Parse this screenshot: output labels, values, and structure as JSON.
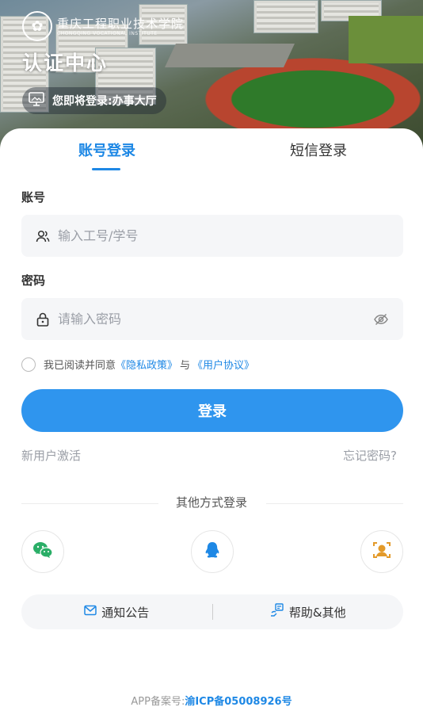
{
  "hero": {
    "logo_text": "重庆工程职业技术学院",
    "logo_sub": "CHONGQING VOCATIONAL INSTITUTE",
    "title": "认证中心",
    "pill_text": "您即将登录:办事大厅"
  },
  "tabs": [
    {
      "label": "账号登录"
    },
    {
      "label": "短信登录"
    }
  ],
  "form": {
    "account_label": "账号",
    "account_placeholder": "输入工号/学号",
    "password_label": "密码",
    "password_placeholder": "请输入密码",
    "agree_prefix": "我已阅读并同意",
    "privacy_link": "《隐私政策》",
    "agree_and": "与",
    "user_agreement_link": "《用户协议》",
    "login_button": "登录",
    "activate_link": "新用户激活",
    "forgot_link": "忘记密码?"
  },
  "other": {
    "title": "其他方式登录",
    "methods": [
      {
        "icon": "wechat-icon",
        "color": "#2aae67"
      },
      {
        "icon": "qq-icon",
        "color": "#1e88e5"
      },
      {
        "icon": "face-id-icon",
        "color": "#e39a2a"
      }
    ]
  },
  "bottom_bar": {
    "notice_label": "通知公告",
    "help_label": "帮助&其他"
  },
  "footer": {
    "prefix": "APP备案号:",
    "icp": "渝ICP备05008926号"
  },
  "colors": {
    "accent": "#1e88e5",
    "button": "#2f95ee"
  }
}
